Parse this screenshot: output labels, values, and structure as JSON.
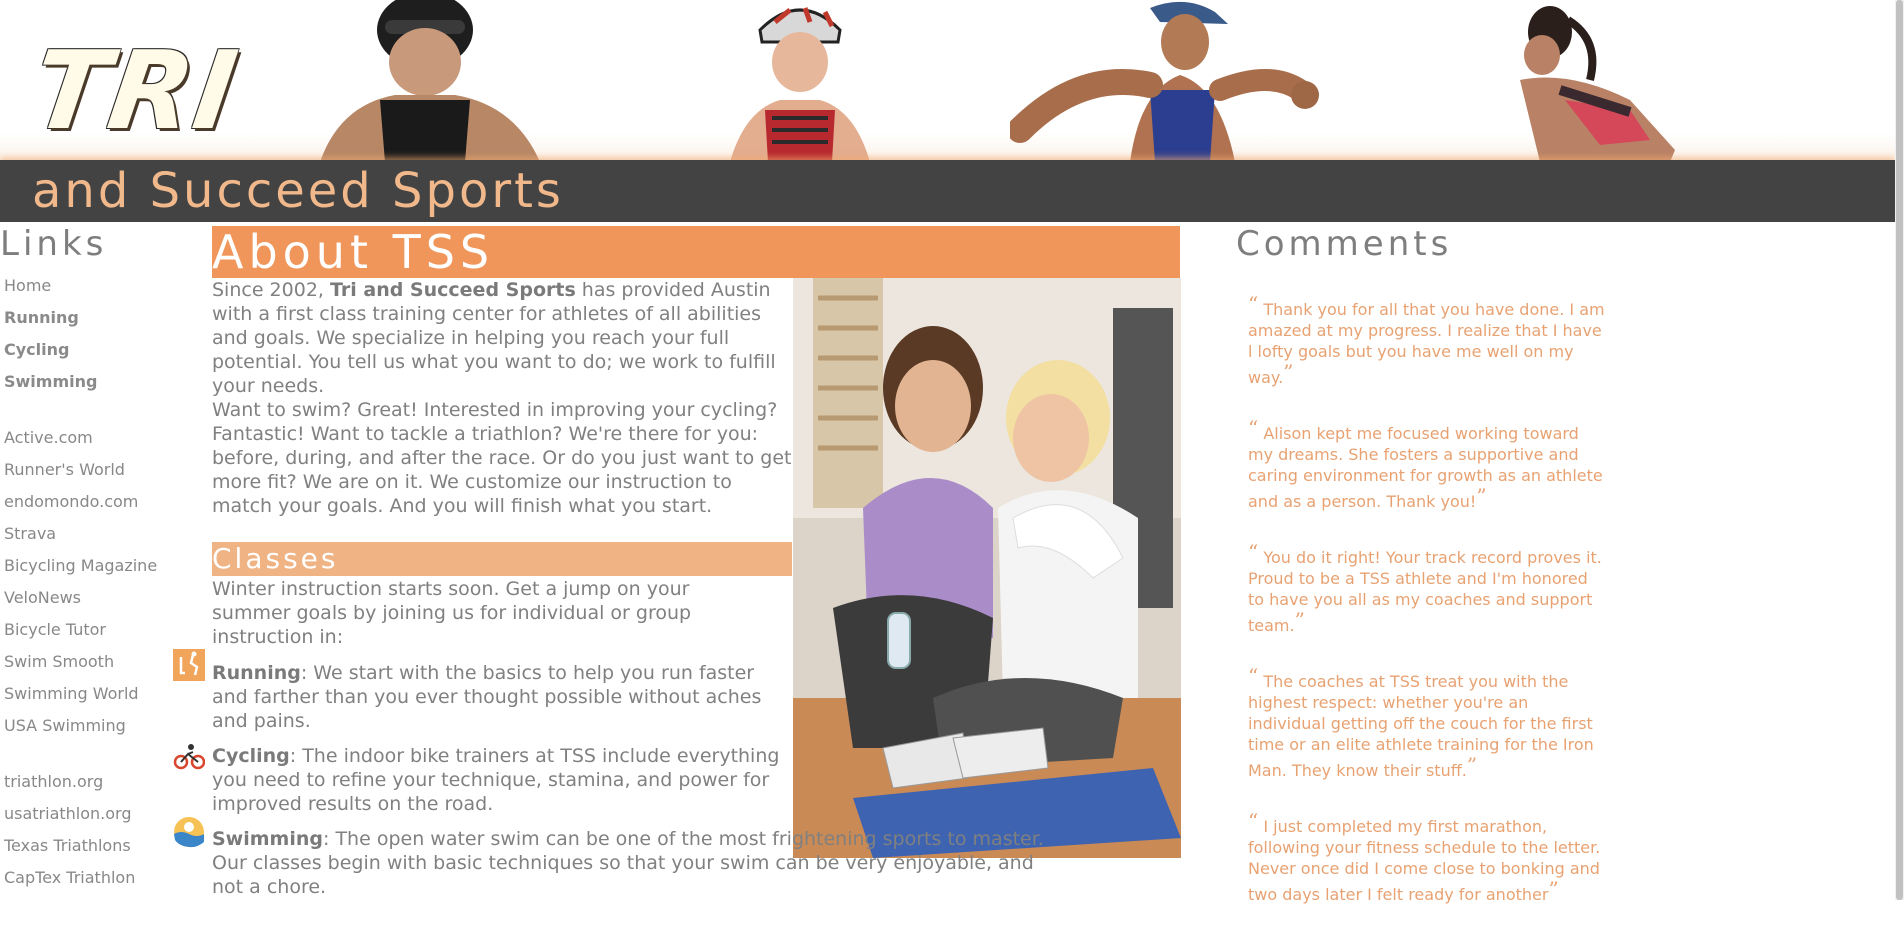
{
  "banner": {
    "logo_main": "TRI",
    "logo_tagline": "and Succeed Sports"
  },
  "sidebar": {
    "title": "Links",
    "groups": [
      [
        {
          "label": "Home",
          "bold": false
        },
        {
          "label": "Running",
          "bold": true
        },
        {
          "label": "Cycling",
          "bold": true
        },
        {
          "label": "Swimming",
          "bold": true
        }
      ],
      [
        {
          "label": "Active.com",
          "bold": false
        },
        {
          "label": "Runner's World",
          "bold": false
        },
        {
          "label": "endomondo.com",
          "bold": false
        },
        {
          "label": "Strava",
          "bold": false
        },
        {
          "label": "Bicycling Magazine",
          "bold": false
        },
        {
          "label": "VeloNews",
          "bold": false
        },
        {
          "label": "Bicycle Tutor",
          "bold": false
        },
        {
          "label": "Swim Smooth",
          "bold": false
        },
        {
          "label": "Swimming World",
          "bold": false
        },
        {
          "label": "USA Swimming",
          "bold": false
        }
      ],
      [
        {
          "label": "triathlon.org",
          "bold": false
        },
        {
          "label": "usatriathlon.org",
          "bold": false
        },
        {
          "label": "Texas Triathlons",
          "bold": false
        },
        {
          "label": "CapTex Triathlon",
          "bold": false
        }
      ]
    ]
  },
  "about": {
    "title": "About TSS",
    "p1_before": "Since 2002, ",
    "p1_bold": "Tri and Succeed Sports",
    "p1_after": " has provided Austin with a first class training center for athletes of all abilities and goals. We specialize in helping you reach your full potential. You tell us what you want to do; we work to fulfill your needs.",
    "p2": "Want to swim? Great! Interested in improving your cycling? Fantastic! Want to tackle a triathlon? We're there for you: before, during, and after the race. Or do you just want to get more fit? We are on it. We customize our instruction to match your goals. And you will finish what you start."
  },
  "classes": {
    "title": "Classes",
    "intro": "Winter instruction starts soon. Get a jump on your summer goals by joining us for individual or group instruction in:",
    "items": [
      {
        "name": "Running",
        "text": ": We start with the basics to help you run faster and farther than you ever thought possible without aches and pains.",
        "icon": "running-icon"
      },
      {
        "name": "Cycling",
        "text": ": The indoor bike trainers at TSS include everything you need to refine your technique, stamina, and power for improved results on the road.",
        "icon": "cycling-icon"
      },
      {
        "name": "Swimming",
        "text": ": The open water swim can be one of the most frightening sports to master. Our classes begin with basic techniques so that your swim can be very enjoyable, and not a chore.",
        "icon": "swimming-icon"
      }
    ]
  },
  "comments": {
    "title": "Comments",
    "open_quote": "“",
    "close_quote": "”",
    "items": [
      "Thank you for all that you have done. I am amazed at my progress. I realize that I have l lofty goals but you have me well on my way.",
      "Alison kept me focused working toward my dreams. She fosters a supportive and caring environment for growth as an athlete and as a person. Thank you!",
      "You do it right! Your track record proves it. Proud to be a TSS athlete and I'm honored to have you all as my coaches and support team.",
      "The coaches at TSS treat you with the highest respect: whether you're an individual getting off the couch for the first time or an elite athlete training for the Iron Man. They know their stuff.",
      "I just completed my first marathon, following your fitness schedule to the letter. Never once did I come close to bonking and two days later I felt ready for another"
    ]
  },
  "colors": {
    "accent_orange": "#f0965a",
    "light_orange": "#f0b384",
    "banner_bar": "#434343",
    "comment_text": "#e8a272"
  }
}
